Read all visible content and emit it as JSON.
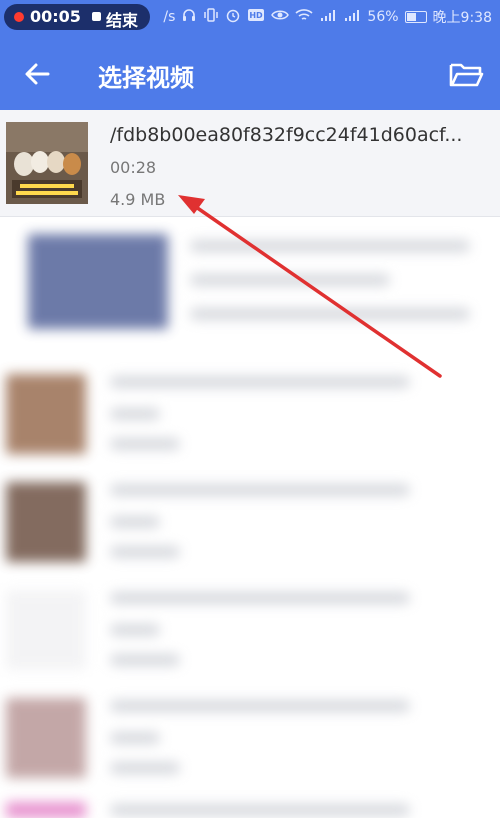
{
  "status_bar": {
    "record_time": "00:05",
    "stop_label": "结束",
    "network_speed": "/s",
    "battery_percent": "56%",
    "clock": "晚上9:38"
  },
  "app_bar": {
    "title": "选择视频"
  },
  "selected_video": {
    "filename": "/fdb8b00ea80f832f9cc24f41d60acf...",
    "duration": "00:28",
    "size": "4.9 MB"
  },
  "colors": {
    "app_bar": "#4e7be9",
    "annotation_arrow": "#e03131"
  },
  "icons": [
    "back-arrow-icon",
    "folder-icon",
    "record-dot-icon",
    "stop-icon",
    "headphones-icon",
    "vibrate-icon",
    "alarm-icon",
    "hd-icon",
    "eye-icon",
    "wifi-icon",
    "signal-icon",
    "battery-icon"
  ]
}
